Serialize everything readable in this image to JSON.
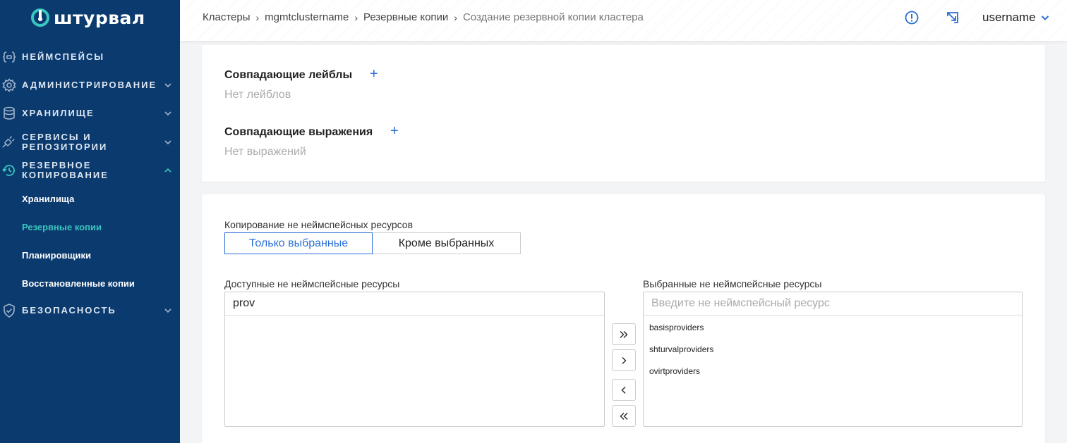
{
  "brand": {
    "name": "штурвал"
  },
  "sidebar": {
    "items": [
      {
        "label": "Неймспейсы"
      },
      {
        "label": "Администрирование"
      },
      {
        "label": "Хранилище"
      },
      {
        "label": "Сервисы и репозитории"
      },
      {
        "label": "Резервное копирование"
      },
      {
        "label": "Безопасность"
      }
    ],
    "subitems": [
      {
        "label": "Хранилища"
      },
      {
        "label": "Резервные копии"
      },
      {
        "label": "Планировщики"
      },
      {
        "label": "Восстановленные копии"
      }
    ]
  },
  "header": {
    "breadcrumbs": [
      "Кластеры",
      "mgmtclustername",
      "Резервные копии",
      "Создание резервной копии кластера"
    ],
    "user": "username"
  },
  "labels_card": {
    "labels_title": "Совпадающие лейблы",
    "labels_empty": "Нет лейблов",
    "expr_title": "Совпадающие выражения",
    "expr_empty": "Нет выражений"
  },
  "resources_card": {
    "mode_label": "Копирование не неймспейсных ресурсов",
    "mode_options": [
      "Только выбранные",
      "Кроме выбранных"
    ],
    "mode_selected": "Только выбранные",
    "available_label": "Доступные не неймспейсные ресурсы",
    "available_filter": "prov",
    "available_items": [],
    "selected_label": "Выбранные не неймспейсные ресурсы",
    "selected_placeholder": "Введите не неймспейсный ресурс",
    "selected_items": [
      "basisproviders",
      "shturvalproviders",
      "ovirtproviders"
    ]
  },
  "colors": {
    "sidebar_bg": "#0b3a6e",
    "accent": "#2a6fd6",
    "active_sub": "#39c5c0"
  }
}
